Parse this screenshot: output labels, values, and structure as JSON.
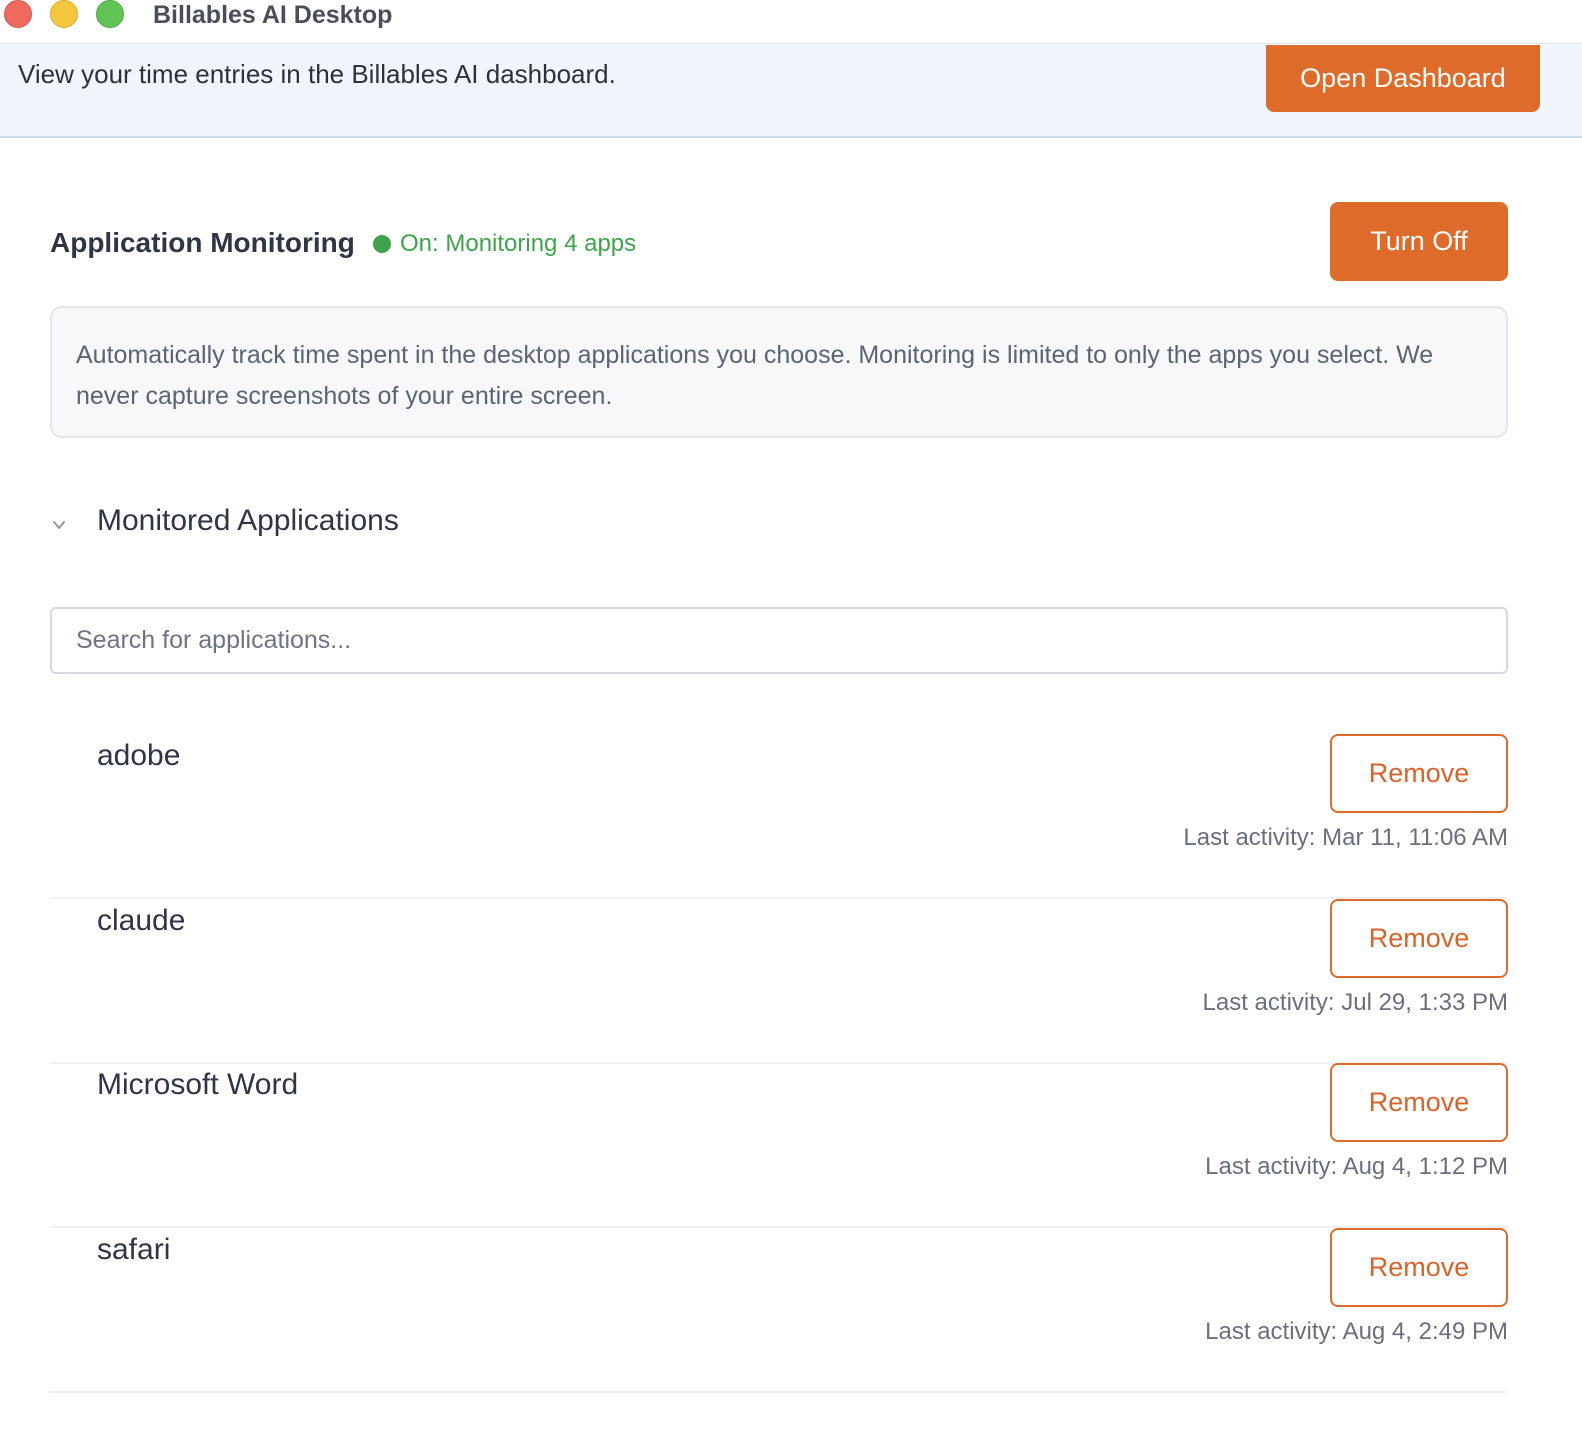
{
  "window": {
    "title": "Billables AI Desktop"
  },
  "banner": {
    "text": "View your time entries in the Billables AI dashboard.",
    "button_label": "Open Dashboard"
  },
  "monitoring": {
    "title": "Application Monitoring",
    "status_text": "On: Monitoring 4 apps",
    "toggle_label": "Turn Off",
    "description": "Automatically track time spent in the desktop applications you choose. Monitoring is limited to only the apps you select. We never capture screenshots of your entire screen."
  },
  "monitored_apps": {
    "title": "Monitored Applications",
    "search_placeholder": "Search for applications...",
    "remove_label": "Remove",
    "items": [
      {
        "name": "adobe",
        "last_activity": "Last activity: Mar 11, 11:06 AM"
      },
      {
        "name": "claude",
        "last_activity": "Last activity: Jul 29, 1:33 PM"
      },
      {
        "name": "Microsoft Word",
        "last_activity": "Last activity: Aug 4, 1:12 PM"
      },
      {
        "name": "safari",
        "last_activity": "Last activity: Aug 4, 2:49 PM"
      }
    ]
  },
  "colors": {
    "accent": "#de6b2a",
    "status_on": "#3ea34a",
    "banner_bg": "#f0f6fc"
  }
}
